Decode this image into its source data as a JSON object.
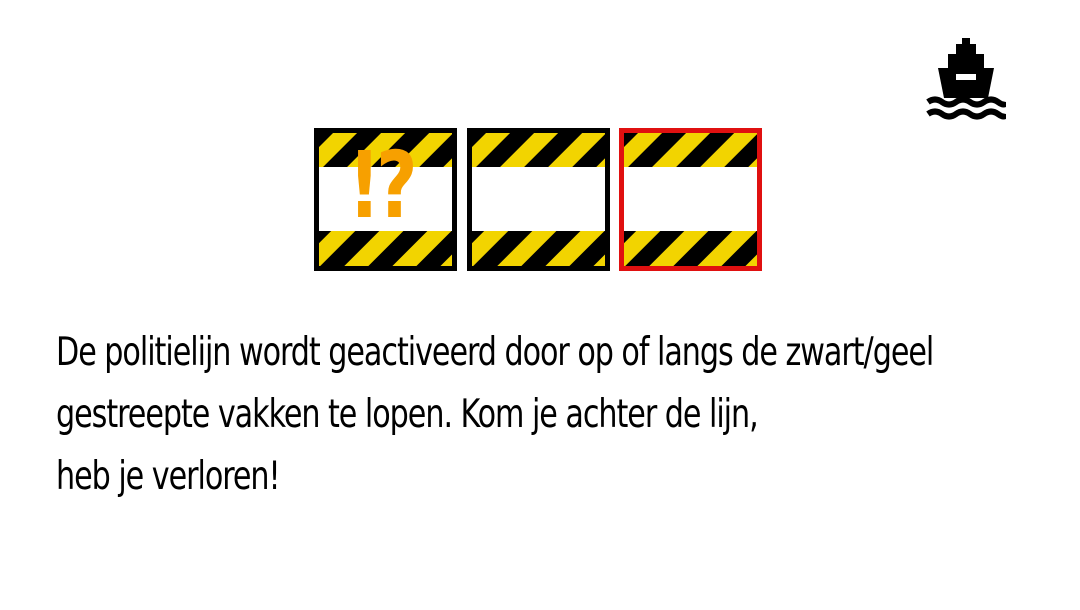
{
  "header": {
    "ship_icon": "ship-icon"
  },
  "tiles": [
    {
      "name": "hazard-tile-question",
      "border_color": "#000000",
      "mark": "!?"
    },
    {
      "name": "hazard-tile-plain",
      "border_color": "#000000",
      "mark": ""
    },
    {
      "name": "hazard-tile-selected",
      "border_color": "#e01010",
      "mark": ""
    }
  ],
  "colors": {
    "stripe_yellow": "#f2d400",
    "stripe_black": "#000000",
    "mark_orange": "#f7a000",
    "selected_border": "#e01010"
  },
  "instructions": {
    "line1": "De politielijn wordt geactiveerd door op of langs de zwart/geel",
    "line2": "gestreepte vakken te lopen. Kom je achter de lijn,",
    "line3": "heb je verloren!"
  }
}
